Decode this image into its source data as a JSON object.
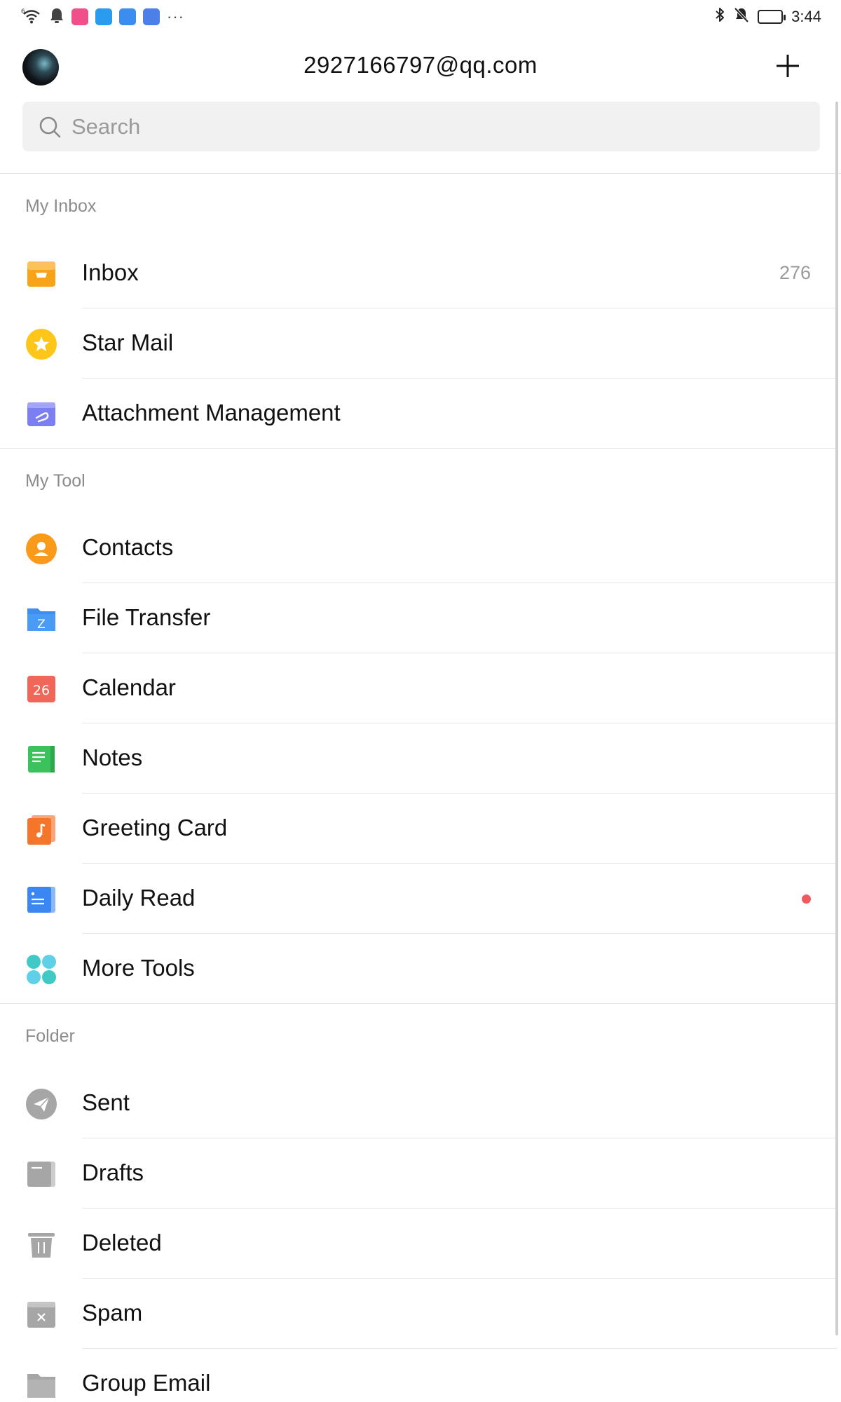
{
  "status_bar": {
    "time": "3:44",
    "network": "6",
    "more": "···"
  },
  "header": {
    "account_email": "2927166797@qq.com"
  },
  "search": {
    "placeholder": "Search"
  },
  "sections": {
    "my_inbox": {
      "title": "My Inbox",
      "items": [
        {
          "label": "Inbox",
          "count": "276",
          "icon": "inbox-tray-icon"
        },
        {
          "label": "Star Mail",
          "icon": "star-icon"
        },
        {
          "label": "Attachment Management",
          "icon": "attachment-folder-icon"
        }
      ]
    },
    "my_tool": {
      "title": "My Tool",
      "items": [
        {
          "label": "Contacts",
          "icon": "contact-person-icon"
        },
        {
          "label": "File Transfer",
          "icon": "file-transfer-folder-icon"
        },
        {
          "label": "Calendar",
          "icon": "calendar-icon",
          "icon_text": "26"
        },
        {
          "label": "Notes",
          "icon": "notes-icon"
        },
        {
          "label": "Greeting Card",
          "icon": "greeting-card-music-icon"
        },
        {
          "label": "Daily Read",
          "icon": "daily-read-icon",
          "has_badge": true
        },
        {
          "label": "More Tools",
          "icon": "more-tools-grid-icon"
        }
      ]
    },
    "folder": {
      "title": "Folder",
      "items": [
        {
          "label": "Sent",
          "icon": "sent-paper-plane-icon"
        },
        {
          "label": "Drafts",
          "icon": "drafts-icon"
        },
        {
          "label": "Deleted",
          "icon": "trash-icon"
        },
        {
          "label": "Spam",
          "icon": "spam-icon"
        },
        {
          "label": "Group Email",
          "icon": "group-email-folder-icon"
        }
      ]
    }
  },
  "colors": {
    "inbox": "#f7a418",
    "star": "#ffc61a",
    "attachment": "#7b7ff3",
    "contacts": "#f99a1b",
    "file_transfer": "#3d8ef0",
    "calendar": "#f0675a",
    "notes": "#3cc25c",
    "greeting_card": "#f5762a",
    "daily_read": "#3a86f2",
    "more_tools": "#41c9c5",
    "folder_gray": "#a6a6a6",
    "badge_red": "#ee5a5f"
  }
}
